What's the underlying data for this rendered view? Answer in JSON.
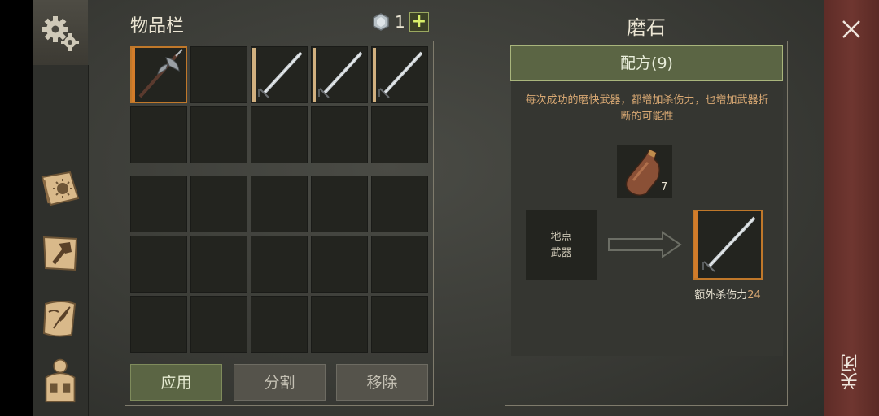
{
  "inventory": {
    "title": "物品栏",
    "gem_count": "1",
    "plus_label": "+",
    "top_slots": [
      "halberd",
      "empty",
      "sword",
      "sword",
      "sword",
      "empty",
      "empty",
      "empty",
      "empty",
      "empty"
    ],
    "bottom_slot_count": 15,
    "buttons": {
      "apply": "应用",
      "split": "分割",
      "remove": "移除"
    }
  },
  "whetstone": {
    "title": "磨石",
    "recipe_label": "配方(9)",
    "description": "每次成功的磨快武器，都增加杀伤力，也增加武器折断的可能性",
    "material_count": "7",
    "weapon_slot_line1": "地点",
    "weapon_slot_line2": "武器",
    "result_label": "额外杀伤力",
    "result_value": "24"
  },
  "sidebar": {
    "icons": [
      "gear-icon",
      "book-icon",
      "crafting-hammer-icon",
      "scroll-quill-icon",
      "backpack-icon"
    ]
  },
  "close": {
    "label": "关闭",
    "icon": "close-icon"
  },
  "colors": {
    "accent_green": "#5b6544",
    "accent_orange": "#c0782a",
    "desc_text": "#d8a873",
    "close_bg": "#6f3630"
  }
}
